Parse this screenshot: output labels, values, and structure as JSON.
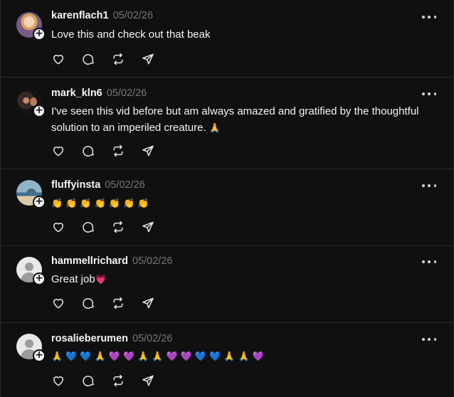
{
  "comments": [
    {
      "username": "karenflach1",
      "date": "05/02/26",
      "text": "Love this and check out that beak",
      "avatar": "user-photo-avatar",
      "more_icon": "more-horizontal-icon"
    },
    {
      "username": "mark_kln6",
      "date": "05/02/26",
      "text_line1": "I've seen this vid before but am always amazed and gratified by the thoughtful",
      "text_line2": "solution to an imperiled creature.",
      "emoji": "🙏"
    },
    {
      "username": "fluffyinsta",
      "date": "05/02/26",
      "emoji": [
        "👏",
        "👏",
        "👏",
        "👏",
        "👏",
        "👏",
        "👏"
      ]
    },
    {
      "username": "hammellrichard",
      "date": "05/02/26",
      "text": "Great job",
      "emoji": "💗",
      "avatar": "default-avatar"
    },
    {
      "username": "rosalieberumen",
      "date": "05/02/26",
      "emoji": [
        "🙏",
        "💙",
        "💙",
        "🙏",
        "💜",
        "💜",
        "🙏",
        "🙏",
        "💜",
        "💜",
        "💙",
        "💙",
        "🙏",
        "🙏",
        "💜"
      ],
      "avatar": "default-avatar"
    }
  ],
  "action_icons": [
    "heart-icon",
    "comment-icon",
    "repost-icon",
    "share-icon"
  ],
  "badge_label": "+",
  "colors": {
    "background": "#101010",
    "text": "#f3f5f7",
    "muted": "#777777",
    "separator": "#2d2d2d"
  }
}
